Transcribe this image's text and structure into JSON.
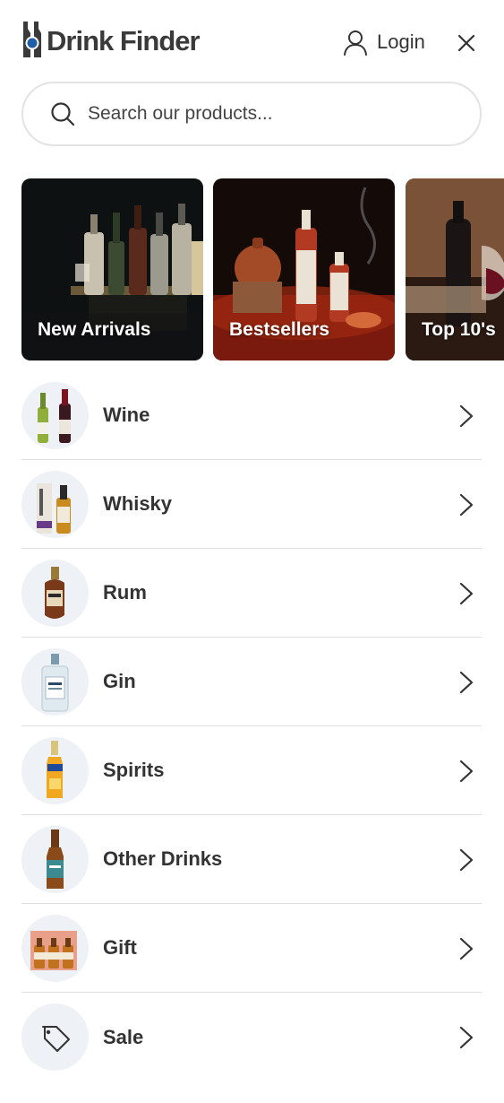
{
  "brand": {
    "name": "Drink Finder",
    "accent_color": "#1f5fa8"
  },
  "header": {
    "login_label": "Login"
  },
  "search": {
    "placeholder": "Search our products..."
  },
  "featured": [
    {
      "label": "New Arrivals"
    },
    {
      "label": "Bestsellers"
    },
    {
      "label": "Top 10's"
    }
  ],
  "categories": [
    {
      "label": "Wine",
      "icon": "wine-bottles-icon"
    },
    {
      "label": "Whisky",
      "icon": "whisky-bottle-icon"
    },
    {
      "label": "Rum",
      "icon": "rum-bottle-icon"
    },
    {
      "label": "Gin",
      "icon": "gin-bottle-icon"
    },
    {
      "label": "Spirits",
      "icon": "spirits-bottle-icon"
    },
    {
      "label": "Other Drinks",
      "icon": "beer-bottle-icon"
    },
    {
      "label": "Gift",
      "icon": "gift-set-icon"
    },
    {
      "label": "Sale",
      "icon": "price-tag-icon"
    }
  ]
}
